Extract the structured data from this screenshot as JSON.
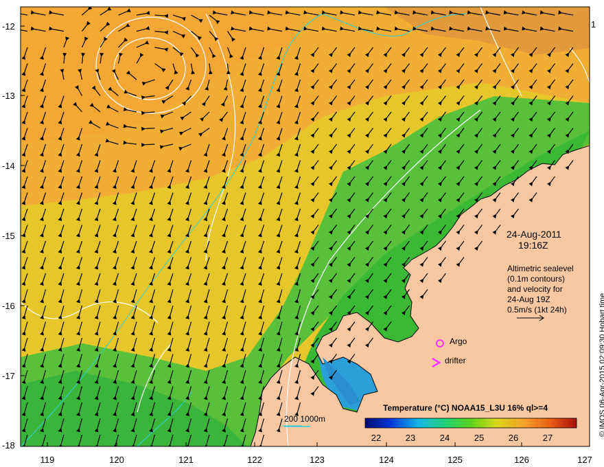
{
  "map": {
    "date": "24-Aug-2011",
    "time": "19:16Z",
    "description_lines": [
      "Altimetric sealevel",
      "(0.1m contours)",
      "and velocity for",
      "24-Aug 19Z",
      "0.5m/s (1kt 24h)"
    ],
    "colorbar_title": "Temperature (°C) NOAA15_L3U 16% ql>=4",
    "colorbar_ticks": [
      "22",
      "23",
      "24",
      "25",
      "26",
      "27"
    ],
    "scale_label": "200  1000m",
    "argo_label": "Argo",
    "drifter_label": "drifter",
    "credit": "© IMOS 06-Apr-2015 02:09:30 Hobart time",
    "lat_ticks": [
      "-12",
      "-13",
      "-14",
      "-15",
      "-16",
      "-17",
      "-18"
    ],
    "lon_ticks": [
      "119",
      "120",
      "121",
      "122",
      "123",
      "124",
      "125",
      "126",
      "127"
    ],
    "right_tick": "1",
    "colors": {
      "land": "#f9c8a0",
      "warm_sea": "#f5a93a",
      "mid_sea": "#e8c72a",
      "cool_sea": "#3fbf36",
      "contour": "#ffffff",
      "isobath": "#2fd0d8",
      "marker": "#ff33ff"
    }
  }
}
